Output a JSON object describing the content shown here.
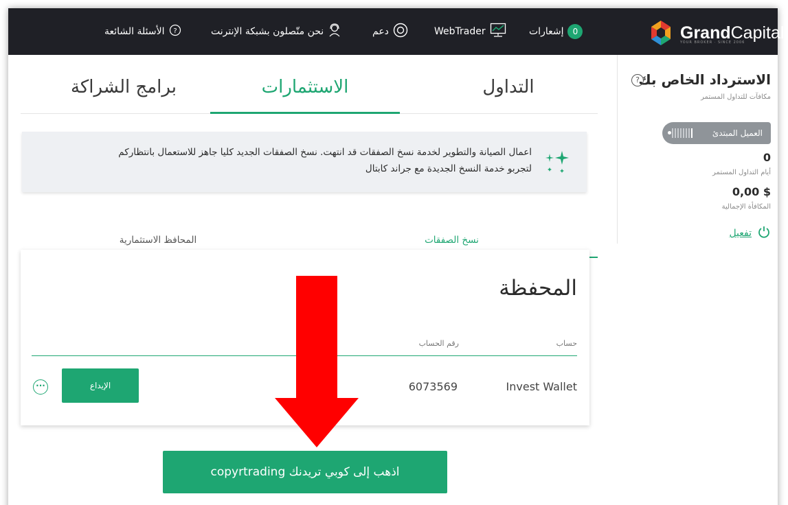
{
  "topbar": {
    "brand_bold": "Grand",
    "brand_light": "Capital",
    "brand_sub": "YOUR BROKER · SINCE 2006",
    "notifications_label": "إشعارات",
    "notifications_count": "0",
    "webtrader_label": "WebTrader",
    "support_label": "دعم",
    "online_label": "نحن متّصلون بشبكة الإنترنت",
    "faq_label": "الأسئلة الشائعة"
  },
  "sidebar": {
    "title": "الاسترداد الخاص بك",
    "subtitle": "مكافآت للتداول المستمر",
    "level_label": "العميل المبتدئ",
    "days_value": "0",
    "days_label": "أيام التداول المستمر",
    "bonus_value": "0,00 $",
    "bonus_label": "المكافأة الإجمالية",
    "activate_label": "تفعيل"
  },
  "tabs": {
    "trading": "التداول",
    "investments": "الاستثمارات",
    "partners": "برامج الشراكة"
  },
  "notice": {
    "line1": "اعمال الصيانة والتطوير لخدمة نسخ الصفقات قد انتهت. نسخ الصفقات الجديد كليا جاهز للاستعمال بانتظاركم",
    "line2": "لتجربو خدمة النسخ الجديدة مع جراند كابتال"
  },
  "subtabs": {
    "copy_trading": "نسخ الصفقات",
    "portfolios": "المحافظ الاستثمارية"
  },
  "portfolio": {
    "title": "المحفظة",
    "col_account": "حساب",
    "col_account_number": "رقم الحساب",
    "row": {
      "account": "Invest Wallet",
      "number": "6073569"
    },
    "deposit_label": "الإيداع",
    "more_label": "···"
  },
  "cta": {
    "label": "اذهب إلى كوبي تريدنك copyrtrading"
  },
  "colors": {
    "accent": "#1ea672",
    "topbar": "#1f2026",
    "arrow": "#ff0000"
  },
  "icons": [
    "help-icon",
    "support-icon",
    "online-agent-icon",
    "webtrader-icon",
    "power-icon",
    "sparkle-icon",
    "down-arrow-icon"
  ]
}
